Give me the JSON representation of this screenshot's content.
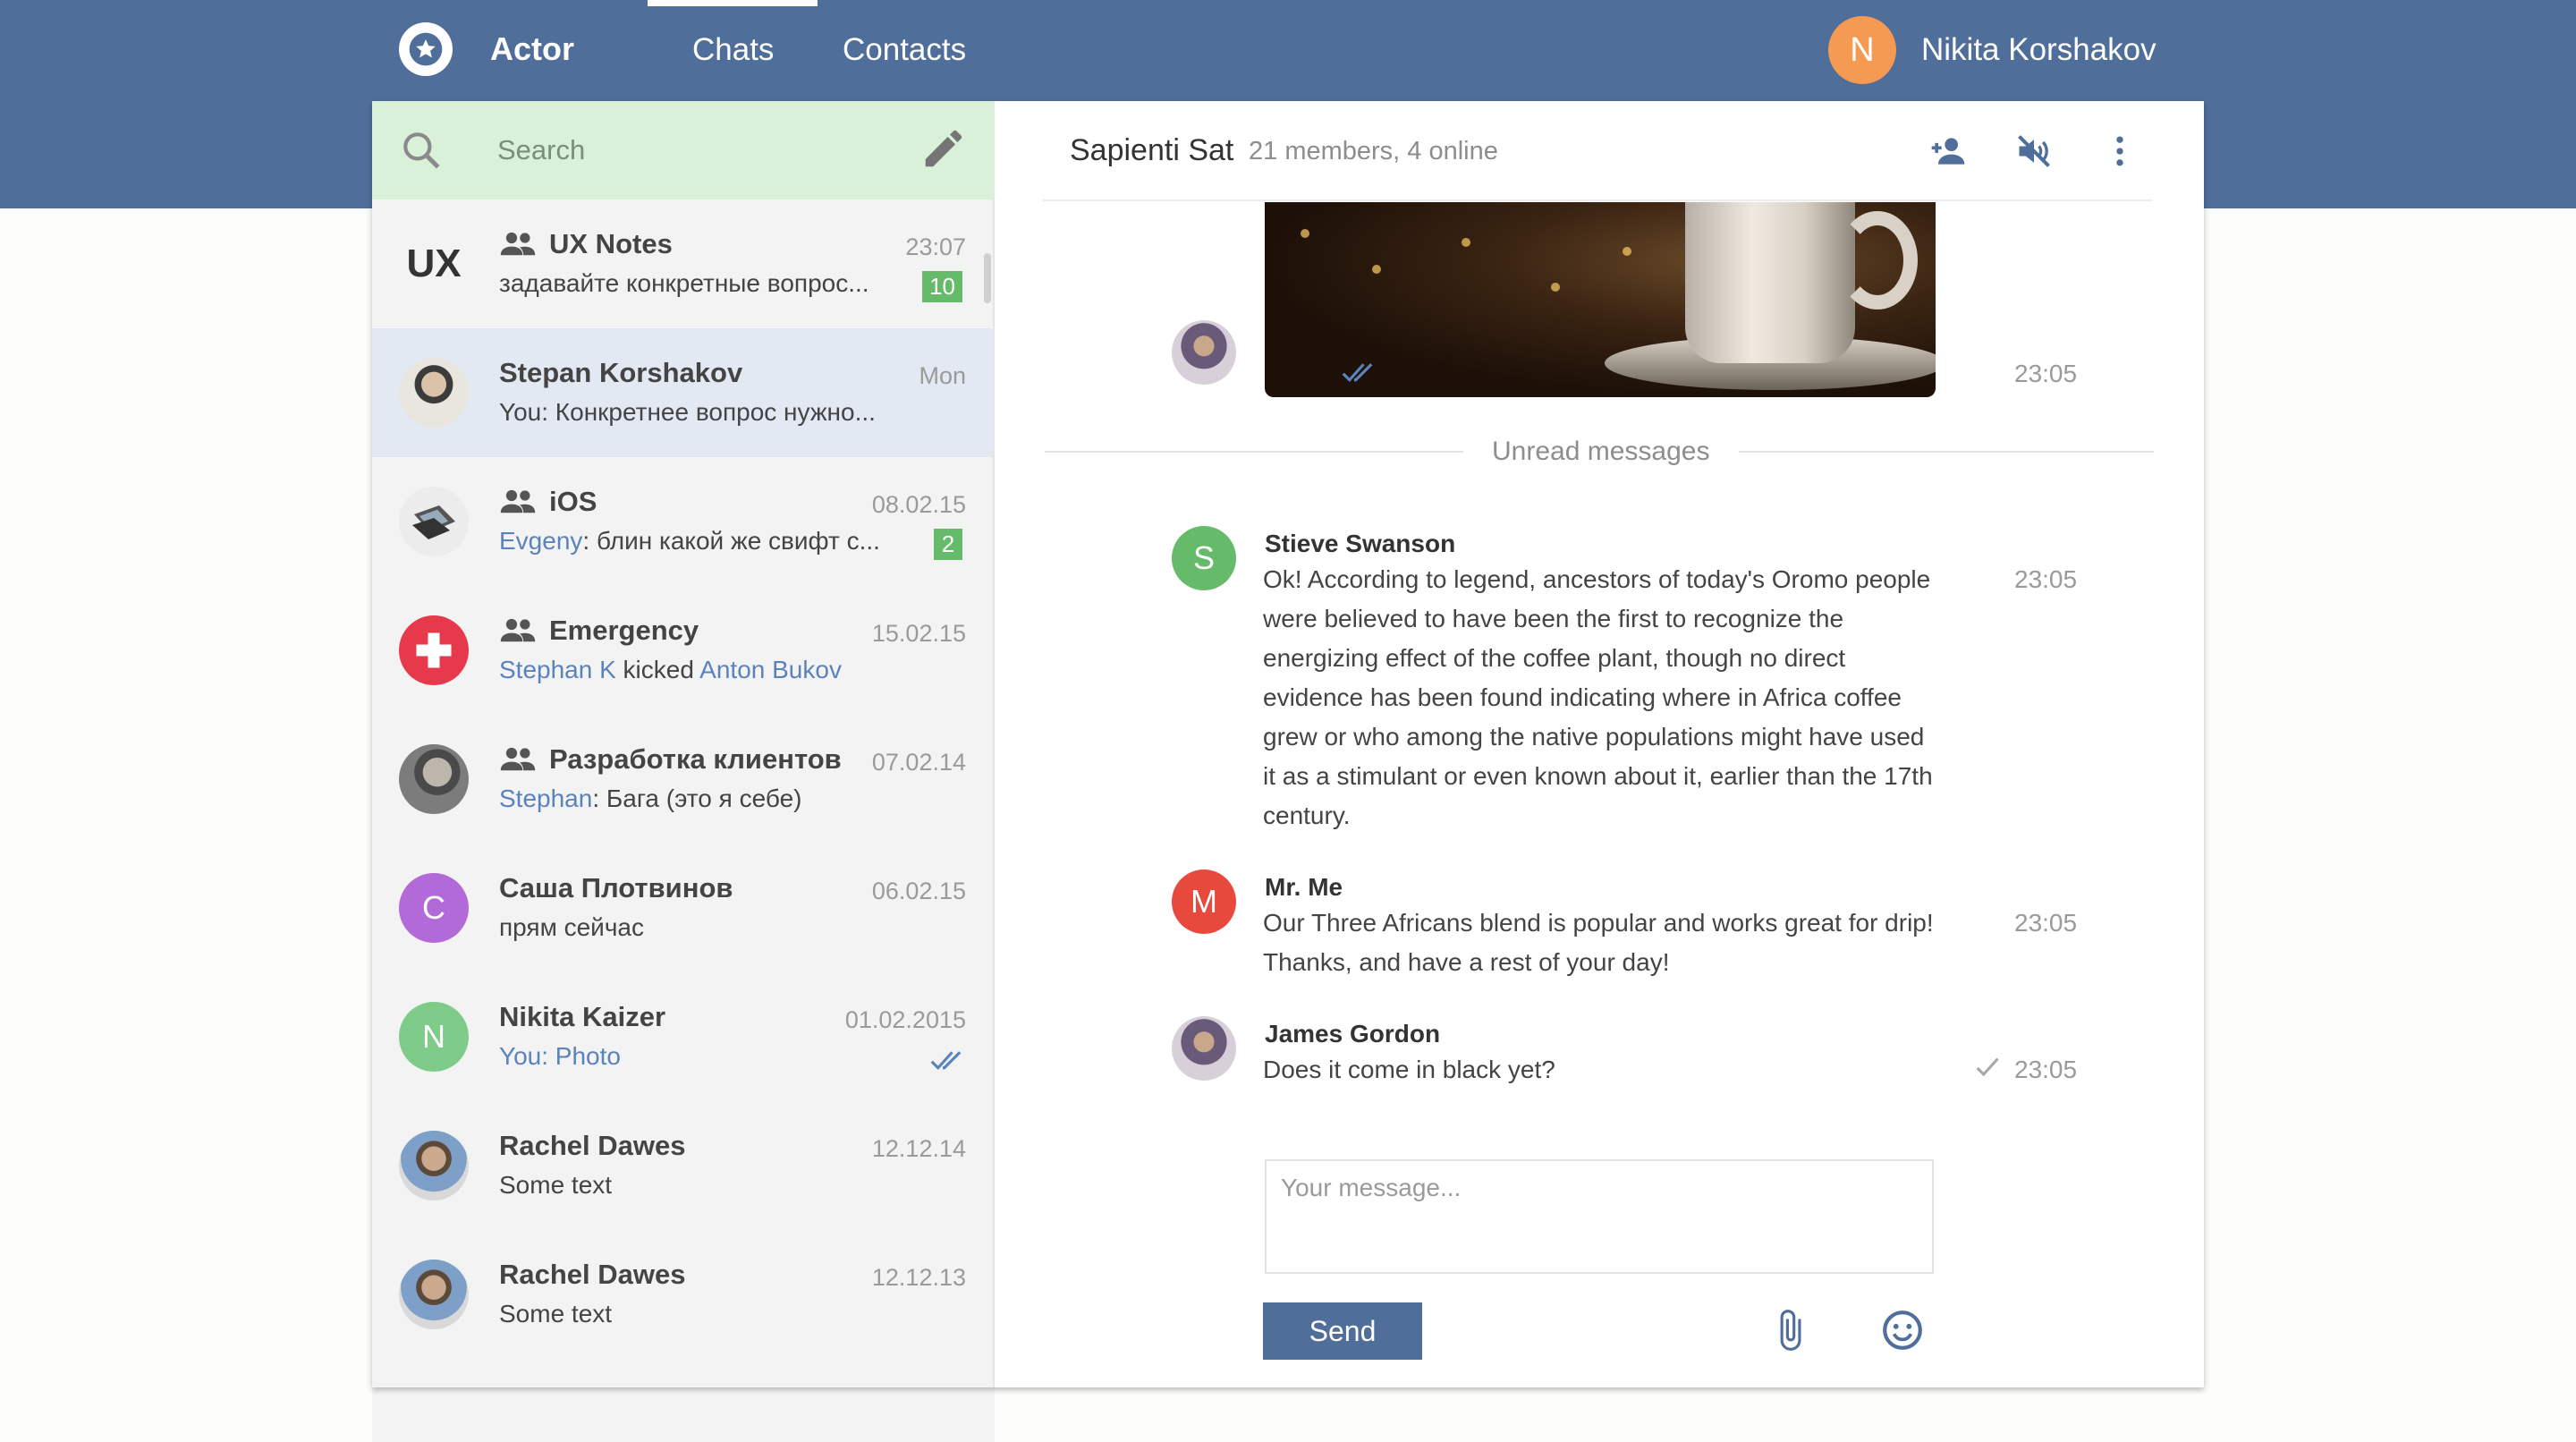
{
  "app": {
    "name": "Actor"
  },
  "nav": {
    "tabs": [
      {
        "label": "Chats",
        "active": true
      },
      {
        "label": "Contacts",
        "active": false
      }
    ]
  },
  "user": {
    "initial": "N",
    "name": "Nikita Korshakov",
    "avatar_color": "#f59a52"
  },
  "colors": {
    "brand": "#4f6e99",
    "accent_green": "#66bb6a",
    "link_blue": "#5b83bb",
    "selected_bg": "#e3e9f3",
    "search_bg": "#d9f0d9"
  },
  "search": {
    "placeholder": "Search",
    "value": ""
  },
  "chats": [
    {
      "avatar_text": "UX",
      "avatar_type": "text",
      "group": true,
      "title": "UX Notes",
      "preview": "задавайте конкретные вопрос...",
      "time": "23:07",
      "unread": "10"
    },
    {
      "avatar_type": "photo",
      "group": false,
      "title": "Stepan Korshakov",
      "preview": "You: Конкретнее вопрос нужно...",
      "time": "Mon",
      "selected": true
    },
    {
      "avatar_type": "photo",
      "group": true,
      "title": "iOS",
      "preview_sender": "Evgeny",
      "preview": ": блин какой же свифт с...",
      "time": "08.02.15",
      "unread": "2"
    },
    {
      "avatar_type": "icon",
      "group": true,
      "title": "Emergency",
      "preview_sender": "Stephan K",
      "preview_mid": " kicked ",
      "preview_target": "Anton Bukov",
      "time": "15.02.15"
    },
    {
      "avatar_type": "photo",
      "group": true,
      "title": "Разработка клиентов",
      "preview_sender": "Stephan",
      "preview": ": Бага (это я себе)",
      "time": "07.02.14"
    },
    {
      "avatar_text": "C",
      "avatar_color": "#b36ad9",
      "group": false,
      "title": "Саша Плотвинов",
      "preview": "прям сейчас",
      "time": "06.02.15"
    },
    {
      "avatar_text": "N",
      "avatar_color": "#7fcb8a",
      "group": false,
      "title": "Nikita Kaizer",
      "preview_sender": "You: Photo",
      "time": "01.02.2015",
      "status": "read"
    },
    {
      "avatar_type": "photo",
      "group": false,
      "title": "Rachel Dawes",
      "preview": "Some text",
      "time": "12.12.14"
    },
    {
      "avatar_type": "photo",
      "group": false,
      "title": "Rachel Dawes",
      "preview": "Some text",
      "time": "12.12.13"
    }
  ],
  "conversation": {
    "name": "Sapienti Sat",
    "members": "21 members, 4 online",
    "photo_message": {
      "time": "23:05",
      "status": "read"
    },
    "unread_label": "Unread messages",
    "messages": [
      {
        "sender": "Stieve Swanson",
        "initial": "S",
        "avatar_color": "#66bb6a",
        "text": "Ok! According to legend, ancestors of today's Oromo people were believed to have been the first to recognize the energizing effect of the coffee plant, though no direct evidence has been found indicating where in Africa coffee grew or who among the native populations might have used it as a stimulant or even known about it, earlier than the 17th century.",
        "time": "23:05"
      },
      {
        "sender": "Mr. Me",
        "initial": "M",
        "avatar_color": "#e74a3c",
        "text": "Our Three Africans blend is popular and works great for drip! Thanks, and have a rest of your day!",
        "time": "23:05"
      },
      {
        "sender": "James Gordon",
        "text": "Does it come in black yet?",
        "time": "23:05",
        "status": "sent"
      }
    ]
  },
  "composer": {
    "placeholder": "Your message...",
    "value": "",
    "send_label": "Send"
  }
}
